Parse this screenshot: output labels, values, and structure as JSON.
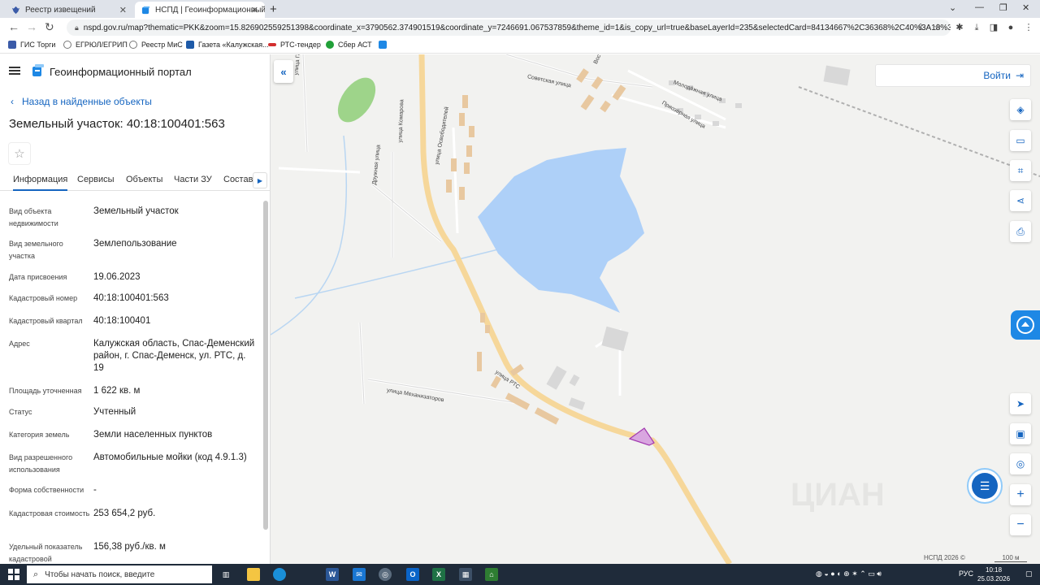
{
  "browser": {
    "tabs": [
      {
        "title": "Реестр извещений"
      },
      {
        "title": "НСПД | Геоинформационный п"
      }
    ],
    "url": "nspd.gov.ru/map?thematic=PKK&zoom=15.826902559251398&coordinate_x=3790562.374901519&coordinate_y=7246691.067537859&theme_id=1&is_copy_url=true&baseLayerId=235&selectedCard=84134667%2C36368%2C40%3A18%3A10040...",
    "bookmarks": [
      "ГИС Торги",
      "ЕГРЮЛ/ЕГРИП",
      "Реестр МиС",
      "Газета «Калужская...",
      "РТС-тендер",
      "Сбер АСТ"
    ]
  },
  "panel": {
    "portal_title": "Геоинформационный портал",
    "back_label": "Назад в найденные объекты",
    "parcel_title": "Земельный участок: 40:18:100401:563",
    "tabs": [
      "Информация",
      "Сервисы",
      "Объекты",
      "Части ЗУ",
      "Состав"
    ],
    "rows": [
      {
        "label": "Вид объекта недвижимости",
        "value": "Земельный участок"
      },
      {
        "label": "Вид земельного участка",
        "value": "Землепользование"
      },
      {
        "label": "Дата присвоения",
        "value": "19.06.2023"
      },
      {
        "label": "Кадастровый номер",
        "value": "40:18:100401:563"
      },
      {
        "label": "Кадастровый квартал",
        "value": "40:18:100401"
      },
      {
        "label": "Адрес",
        "value": "Калужская область, Спас-Деменский район, г. Спас-Деменск, ул. РТС, д. 19"
      },
      {
        "label": "Площадь уточненная",
        "value": "1 622 кв. м"
      },
      {
        "label": "Статус",
        "value": "Учтенный"
      },
      {
        "label": "Категория земель",
        "value": "Земли населенных пунктов"
      },
      {
        "label": "Вид разрешенного использования",
        "value": "Автомобильные мойки (код 4.9.1.3)"
      },
      {
        "label": "Форма собственности",
        "value": "-"
      },
      {
        "label": "Кадастровая стоимость",
        "value": "253 654,2 руб."
      },
      {
        "label": "Удельный показатель кадастровой",
        "value": "156,38 руб./кв. м"
      }
    ]
  },
  "map": {
    "login_label": "Войти",
    "copyright": "НСПД 2026 ©",
    "scale": "100 м",
    "streets": {
      "sovetskaya": "Советская улица",
      "vostochnaya": "Восточная",
      "molodezhnaya": "Молодёжная улица",
      "priozernaya": "Приозёрная улица",
      "komarova": "улица Комарова",
      "osvoboditeley": "улица Освободителей",
      "druzhnaya": "Дружная улица",
      "rts": "улица РТС",
      "mekhanizatorov": "улица Механизаторов",
      "top_left": "улица Гаг"
    },
    "watermark": "ЦИАН"
  },
  "taskbar": {
    "search_placeholder": "Чтобы начать поиск, введите",
    "lang": "РУС",
    "time": "10:18",
    "date": "25.03.2026"
  },
  "colors": {
    "accent": "#1565c0",
    "water": "#aed0f8",
    "road": "#f6d79a",
    "building": "#e8c8a0",
    "parcel": "#d9a6e0"
  }
}
